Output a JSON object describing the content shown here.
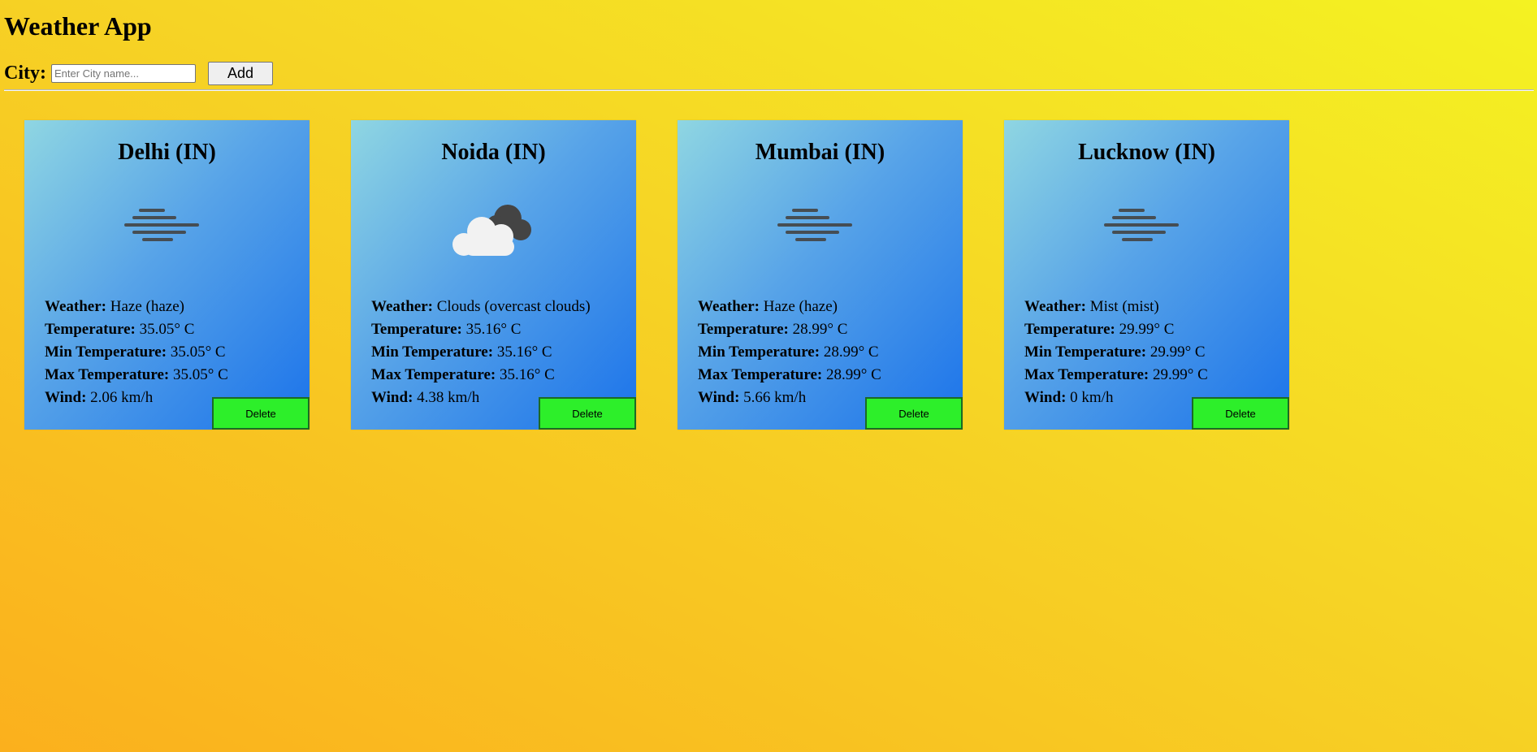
{
  "app": {
    "title": "Weather App"
  },
  "form": {
    "label": "City:",
    "placeholder": "Enter City name...",
    "add_label": "Add"
  },
  "cards": [
    {
      "city": "Delhi (IN)",
      "icon": "haze-icon",
      "weather_label": "Weather:",
      "weather": "Haze (haze)",
      "temp_label": "Temperature:",
      "temp": "35.05° C",
      "min_label": "Min Temperature:",
      "min": "35.05° C",
      "max_label": "Max Temperature:",
      "max": "35.05° C",
      "wind_label": "Wind:",
      "wind": "2.06 km/h",
      "delete_label": "Delete"
    },
    {
      "city": "Noida (IN)",
      "icon": "clouds-icon",
      "weather_label": "Weather:",
      "weather": "Clouds (overcast clouds)",
      "temp_label": "Temperature:",
      "temp": "35.16° C",
      "min_label": "Min Temperature:",
      "min": "35.16° C",
      "max_label": "Max Temperature:",
      "max": "35.16° C",
      "wind_label": "Wind:",
      "wind": "4.38 km/h",
      "delete_label": "Delete"
    },
    {
      "city": "Mumbai (IN)",
      "icon": "haze-icon",
      "weather_label": "Weather:",
      "weather": "Haze (haze)",
      "temp_label": "Temperature:",
      "temp": "28.99° C",
      "min_label": "Min Temperature:",
      "min": "28.99° C",
      "max_label": "Max Temperature:",
      "max": "28.99° C",
      "wind_label": "Wind:",
      "wind": "5.66 km/h",
      "delete_label": "Delete"
    },
    {
      "city": "Lucknow (IN)",
      "icon": "mist-icon",
      "weather_label": "Weather:",
      "weather": "Mist (mist)",
      "temp_label": "Temperature:",
      "temp": "29.99° C",
      "min_label": "Min Temperature:",
      "min": "29.99° C",
      "max_label": "Max Temperature:",
      "max": "29.99° C",
      "wind_label": "Wind:",
      "wind": "0 km/h",
      "delete_label": "Delete"
    }
  ],
  "colors": {
    "delete_bg": "#2def2a",
    "card_top": "#8fd6e2",
    "card_bottom": "#1b73ea",
    "icon_dark": "#444444"
  }
}
